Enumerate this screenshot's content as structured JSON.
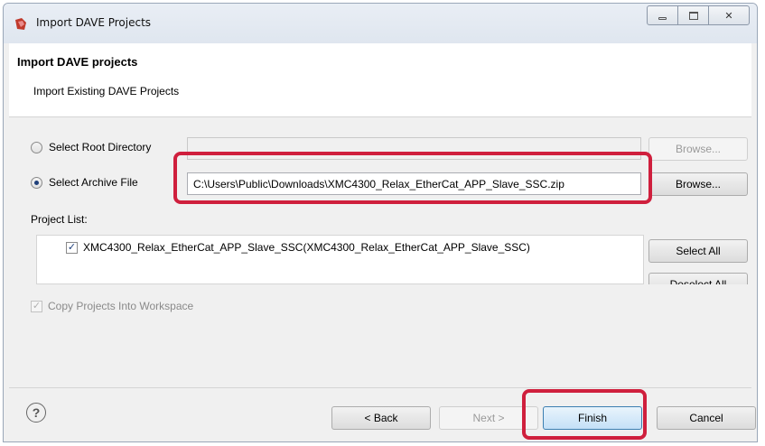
{
  "window": {
    "title": "Import DAVE Projects"
  },
  "header": {
    "title": "Import DAVE projects",
    "subtitle": "Import Existing DAVE Projects"
  },
  "root_directory": {
    "label": "Select Root Directory",
    "value": "",
    "browse_label": "Browse..."
  },
  "archive_file": {
    "label": "Select Archive File",
    "value": "C:\\Users\\Public\\Downloads\\XMC4300_Relax_EtherCat_APP_Slave_SSC.zip",
    "browse_label": "Browse..."
  },
  "project_list": {
    "label": "Project List:",
    "items": [
      {
        "name": "XMC4300_Relax_EtherCat_APP_Slave_SSC(XMC4300_Relax_EtherCat_APP_Slave_SSC)",
        "checked": true
      }
    ],
    "select_all_label": "Select All",
    "deselect_all_label": "Deselect All"
  },
  "copy_into_workspace": {
    "label": "Copy Projects Into Workspace",
    "checked": true
  },
  "footer": {
    "help_symbol": "?",
    "back_label": "< Back",
    "next_label": "Next >",
    "finish_label": "Finish",
    "cancel_label": "Cancel"
  },
  "colors": {
    "highlight": "#cf1f3d",
    "accent": "#3c7fb1"
  },
  "icons": {
    "app": "dave-app-icon",
    "help": "help-icon"
  }
}
